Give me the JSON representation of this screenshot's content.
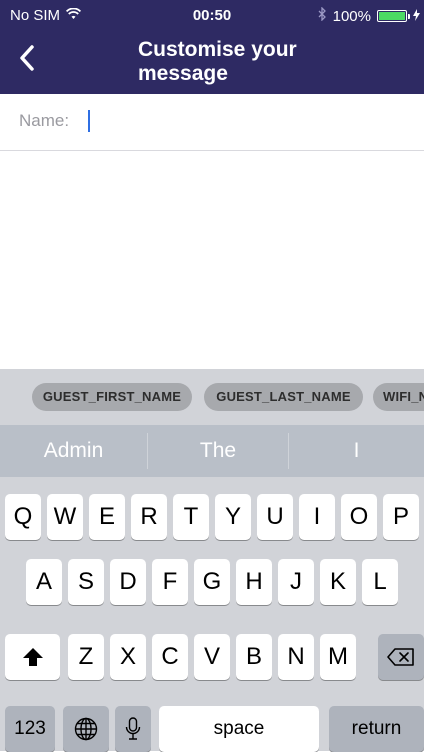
{
  "status_bar": {
    "carrier": "No SIM",
    "time": "00:50",
    "battery": "100%",
    "icons": [
      "wifi-icon",
      "bluetooth-icon",
      "battery-icon",
      "charging-icon"
    ]
  },
  "nav": {
    "title": "Customise your message",
    "back_icon": "chevron-left-icon",
    "accent_color": "#2e2a63"
  },
  "form": {
    "name_label": "Name:",
    "name_value": ""
  },
  "tokens": [
    "GUEST_FIRST_NAME",
    "GUEST_LAST_NAME",
    "WIFI_N"
  ],
  "predictions": [
    "Admin",
    "The",
    "I"
  ],
  "keyboard": {
    "row1": [
      "Q",
      "W",
      "E",
      "R",
      "T",
      "Y",
      "U",
      "I",
      "O",
      "P"
    ],
    "row2": [
      "A",
      "S",
      "D",
      "F",
      "G",
      "H",
      "J",
      "K",
      "L"
    ],
    "row3": [
      "Z",
      "X",
      "C",
      "V",
      "B",
      "N",
      "M"
    ],
    "numbers_label": "123",
    "space_label": "space",
    "return_label": "return",
    "shift_icon": "shift-icon",
    "globe_icon": "globe-icon",
    "mic_icon": "microphone-icon",
    "backspace_icon": "backspace-icon"
  }
}
